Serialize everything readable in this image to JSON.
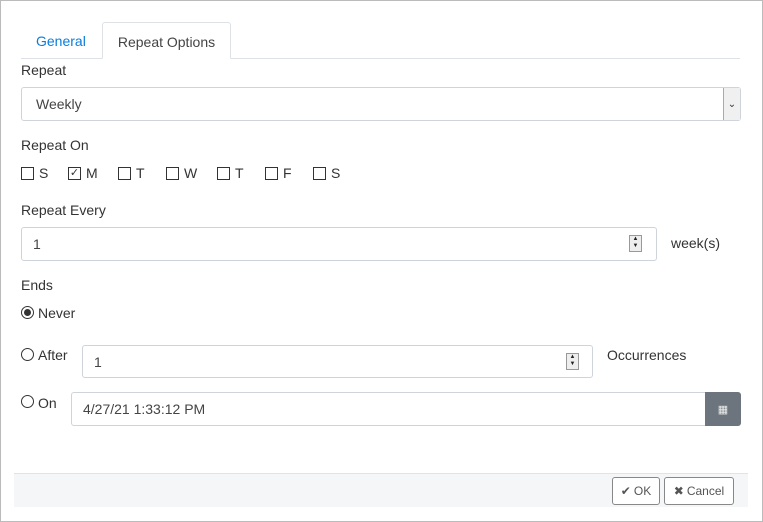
{
  "tabs": [
    {
      "label": "General",
      "active": false
    },
    {
      "label": "Repeat Options",
      "active": true
    }
  ],
  "repeat": {
    "label": "Repeat",
    "value": "Weekly"
  },
  "repeat_on": {
    "label": "Repeat On",
    "days": [
      {
        "label": "S",
        "checked": false
      },
      {
        "label": "M",
        "checked": true
      },
      {
        "label": "T",
        "checked": false
      },
      {
        "label": "W",
        "checked": false
      },
      {
        "label": "T",
        "checked": false
      },
      {
        "label": "F",
        "checked": false
      },
      {
        "label": "S",
        "checked": false
      }
    ]
  },
  "repeat_every": {
    "label": "Repeat Every",
    "value": "1",
    "unit": "week(s)"
  },
  "ends": {
    "label": "Ends",
    "never": "Never",
    "after": "After",
    "after_value": "1",
    "occurrences": "Occurrences",
    "on": "On",
    "on_value": "4/27/21 1:33:12 PM",
    "selected": "Never"
  },
  "footer": {
    "ok": "OK",
    "cancel": "Cancel",
    "ok_icon": "check-icon",
    "cancel_icon": "x-icon"
  },
  "colors": {
    "accent": "#0a7cdb",
    "calendar_button": "#6c757d"
  }
}
